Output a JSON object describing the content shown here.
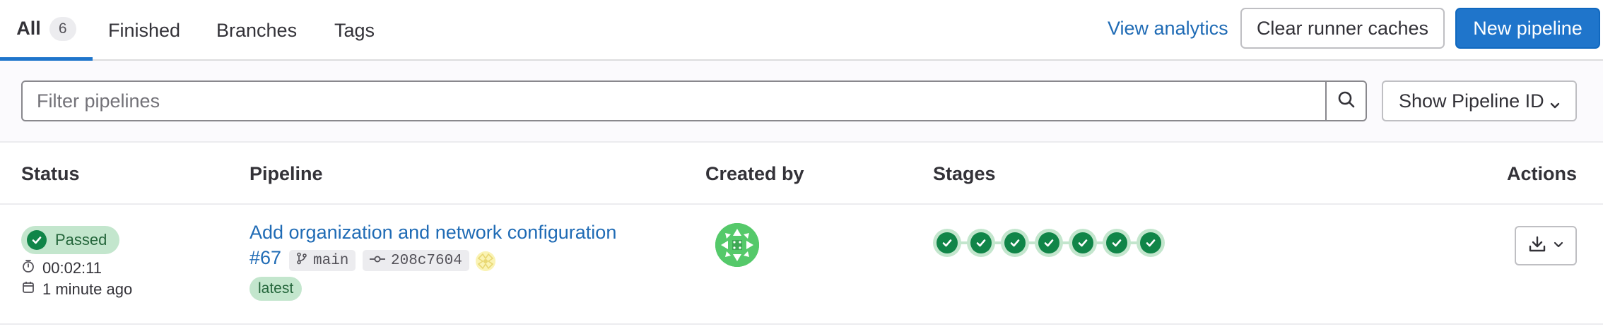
{
  "tabs": [
    {
      "label": "All",
      "count": "6",
      "active": true
    },
    {
      "label": "Finished"
    },
    {
      "label": "Branches"
    },
    {
      "label": "Tags"
    }
  ],
  "header_actions": {
    "analytics_link": "View analytics",
    "clear_caches_button": "Clear runner caches",
    "new_pipeline_button": "New pipeline"
  },
  "filter": {
    "search_placeholder": "Filter pipelines",
    "show_id_label": "Show Pipeline ID"
  },
  "table": {
    "columns": [
      "Status",
      "Pipeline",
      "Created by",
      "Stages",
      "Actions"
    ],
    "rows": [
      {
        "status": "Passed",
        "duration": "00:02:11",
        "finished": "1 minute ago",
        "title": "Add organization and network configuration",
        "id": "#67",
        "ref": "main",
        "commit": "208c7604",
        "badge": "latest",
        "stages_passed": 7
      }
    ]
  },
  "colors": {
    "primary": "#1f75cb",
    "link": "#1f6bb5",
    "success": "#108548",
    "success_bg": "#c3e6cd",
    "avatar_green": "#55c96a",
    "avatar_yellow": "#faf3b4"
  },
  "icons": [
    "search-icon",
    "chevron-down-icon",
    "check-icon",
    "timer-icon",
    "calendar-icon",
    "branch-icon",
    "commit-icon",
    "download-icon"
  ]
}
